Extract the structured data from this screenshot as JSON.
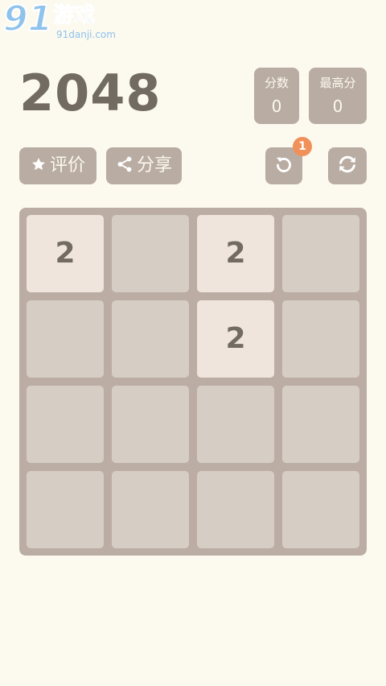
{
  "watermark": {
    "number": "91",
    "name": "游戏",
    "url": "91danji.com"
  },
  "header": {
    "title": "2048",
    "score_label": "分数",
    "score_value": "0",
    "best_label": "最高分",
    "best_value": "0"
  },
  "toolbar": {
    "rate_label": "评价",
    "rate_icon": "star-icon",
    "share_label": "分享",
    "share_icon": "share-icon",
    "undo_icon": "undo-icon",
    "undo_badge": "1",
    "restart_icon": "restart-icon"
  },
  "board": {
    "rows": [
      [
        "2",
        "",
        "2",
        ""
      ],
      [
        "",
        "",
        "2",
        ""
      ],
      [
        "",
        "",
        "",
        ""
      ],
      [
        "",
        "",
        "",
        ""
      ]
    ]
  },
  "colors": {
    "background": "#fcf9ef",
    "board": "#bbada3",
    "empty_cell": "#d6cdc4",
    "tile_2": "#efe5dc",
    "text_dark": "#716b62",
    "button": "#b9aca2",
    "badge": "#f2905a"
  }
}
